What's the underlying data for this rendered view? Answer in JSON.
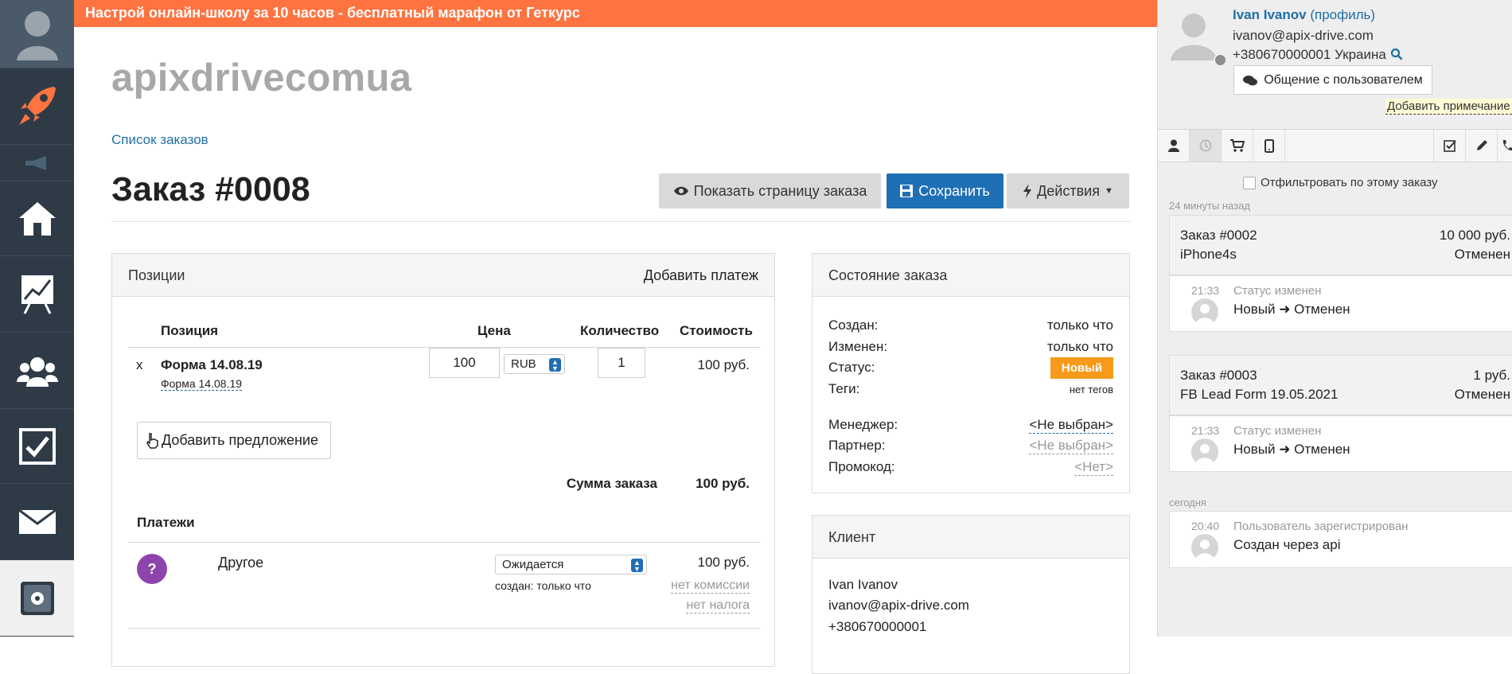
{
  "colors": {
    "banner": "#ff7340",
    "sidebar": "#2e3b47",
    "accent": "#1f6fb5",
    "status_new": "#f79a1a",
    "payment_icon": "#8e44ad"
  },
  "banner": {
    "text": "Настрой онлайн-школу за 10 часов - бесплатный марафон от Геткурс"
  },
  "sidebar": {
    "items": [
      "user-icon",
      "rocket-icon",
      "megaphone-icon",
      "home-icon",
      "chart-icon",
      "people-icon",
      "checkbox-icon",
      "mail-icon",
      "settings-icon"
    ]
  },
  "header": {
    "site_title": "apixdrivecomua",
    "breadcrumb": "Список заказов",
    "order_title": "Заказ #0008",
    "buttons": {
      "show_page": "Показать страницу заказа",
      "save": "Сохранить",
      "actions": "Действия"
    }
  },
  "positions": {
    "title": "Позиции",
    "add_payment": "Добавить платеж",
    "columns": {
      "position": "Позиция",
      "price": "Цена",
      "quantity": "Количество",
      "cost": "Стоимость"
    },
    "row": {
      "remove": "x",
      "name": "Форма 14.08.19",
      "sub": "Форма 14.08.19",
      "price": "100",
      "currency": "RUB",
      "quantity": "1",
      "cost": "100 руб."
    },
    "add_offer": "Добавить предложение",
    "sum_label": "Сумма заказа",
    "sum_value": "100 руб."
  },
  "payments": {
    "title": "Платежи",
    "icon_text": "?",
    "name": "Другое",
    "status": "Ожидается",
    "created": "создан: только что",
    "amount": "100 руб.",
    "commission": "нет комиссии",
    "tax": "нет налога"
  },
  "order_state": {
    "title": "Состояние заказа",
    "created_label": "Создан:",
    "created_value": "только что",
    "changed_label": "Изменен:",
    "changed_value": "только что",
    "status_label": "Статус:",
    "status_value": "Новый",
    "tags_label": "Теги:",
    "tags_value": "нет тегов",
    "manager_label": "Менеджер:",
    "manager_value": "<Не выбран>",
    "partner_label": "Партнер:",
    "partner_value": "<Не выбран>",
    "promo_label": "Промокод:",
    "promo_value": "<Нет>"
  },
  "client": {
    "title": "Клиент",
    "name": "Ivan Ivanov",
    "email": "ivanov@apix-drive.com",
    "phone": "+380670000001"
  },
  "user_panel": {
    "name": "Ivan Ivanov",
    "profile": "(профиль)",
    "email": "ivanov@apix-drive.com",
    "phone": "+380670000001 Украина",
    "chat_button": "Общение с пользователем",
    "add_note": "Добавить примечание",
    "tabs": [
      "user-icon",
      "history-icon",
      "cart-icon",
      "mobile-icon",
      "check-icon",
      "pencil-icon",
      "phone-icon"
    ],
    "filter_label": "Отфильтровать по этому заказу",
    "time_ago": "24 минуты назад",
    "events": [
      {
        "order": "Заказ #0002",
        "amount": "10 000 руб.",
        "product": "iPhone4s",
        "state": "Отменен",
        "time": "21:33",
        "event": "Статус изменен",
        "change": "Новый ➜ Отменен"
      },
      {
        "order": "Заказ #0003",
        "amount": "1 руб.",
        "product": "FB Lead Form 19.05.2021",
        "state": "Отменен",
        "time": "21:33",
        "event": "Статус изменен",
        "change": "Новый ➜ Отменен"
      }
    ],
    "today_label": "сегодня",
    "registration": {
      "time": "20:40",
      "event": "Пользователь зарегистрирован",
      "detail": "Создан через api"
    }
  }
}
